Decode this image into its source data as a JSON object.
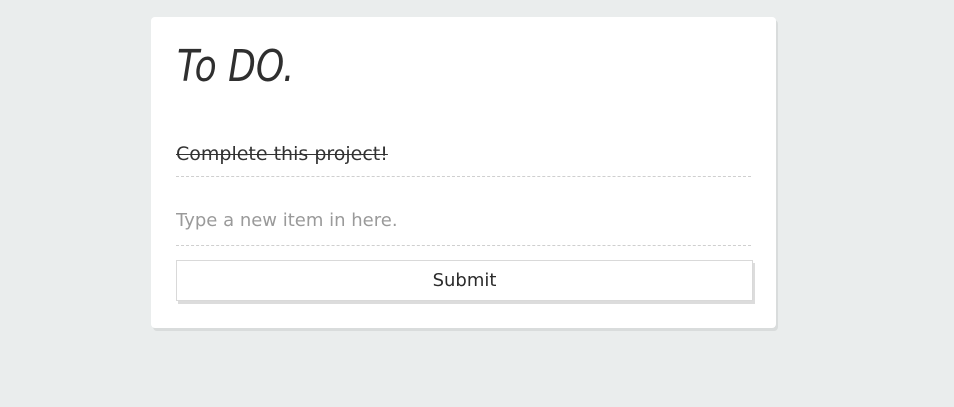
{
  "card": {
    "title": "To DO."
  },
  "todos": {
    "items": [
      {
        "text": "Complete this project!",
        "completed": true
      }
    ]
  },
  "new_item": {
    "placeholder": "Type a new item in here.",
    "value": ""
  },
  "form": {
    "submit_label": "Submit"
  },
  "colors": {
    "background": "#eaeded",
    "card": "#ffffff",
    "text": "#333333",
    "placeholder": "#9a9a9a",
    "divider": "#cfcfcf"
  }
}
